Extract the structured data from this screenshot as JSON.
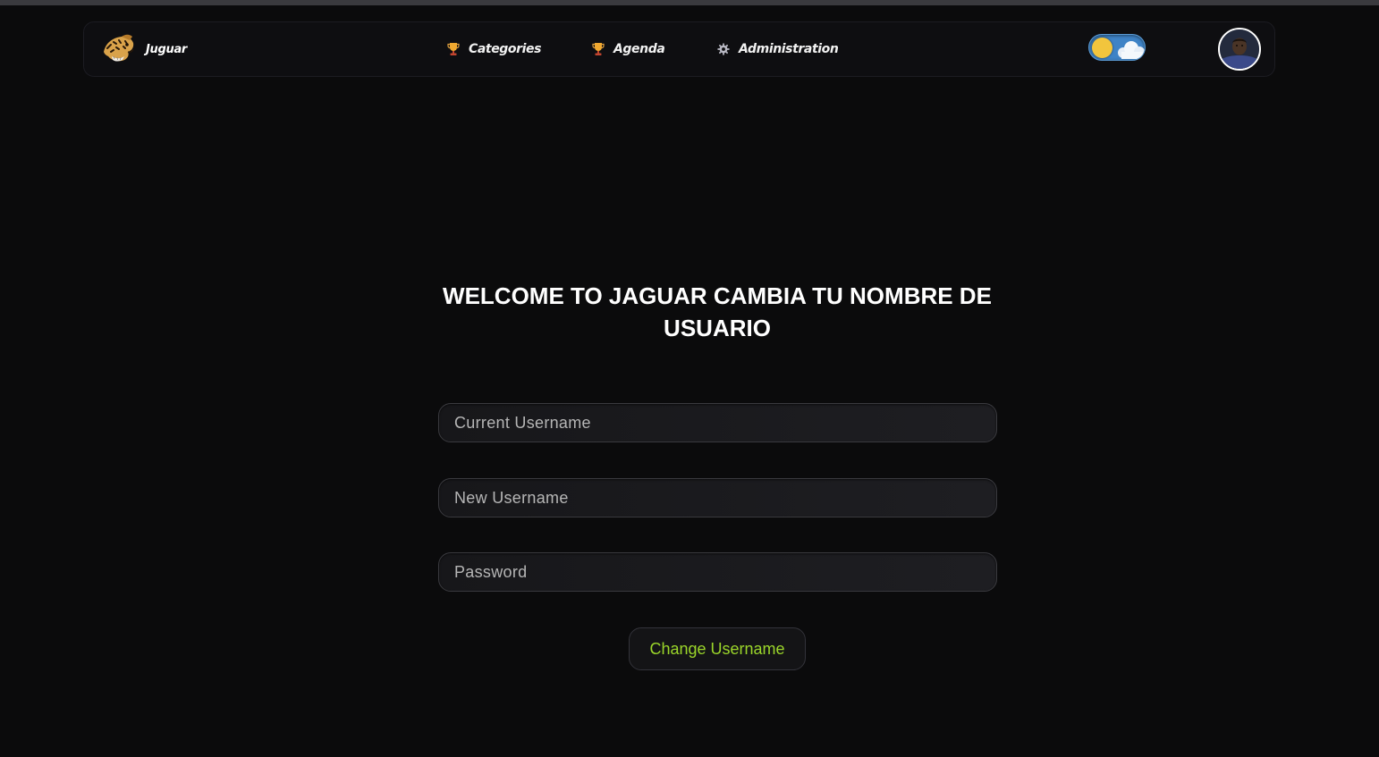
{
  "navbar": {
    "brand": {
      "name": "Juguar",
      "logo_icon": "jaguar-head-icon"
    },
    "items": [
      {
        "label": "Categories",
        "icon": "trophy-icon"
      },
      {
        "label": "Agenda",
        "icon": "trophy-icon"
      },
      {
        "label": "Administration",
        "icon": "gear-icon"
      }
    ],
    "theme_toggle": {
      "state": "light",
      "icon": "sun-cloud-icon"
    },
    "avatar": {
      "icon": "user-avatar"
    }
  },
  "main": {
    "title": "WELCOME TO JAGUAR CAMBIA TU NOMBRE DE USUARIO",
    "fields": {
      "current_username": {
        "placeholder": "Current Username",
        "value": ""
      },
      "new_username": {
        "placeholder": "New Username",
        "value": ""
      },
      "password": {
        "placeholder": "Password",
        "value": ""
      }
    },
    "submit_label": "Change Username"
  },
  "colors": {
    "background": "#0b0b0c",
    "navbar": "#0e0e11",
    "accent_green": "#9bd62a",
    "toggle_blue": "#3e83c6",
    "toggle_sun": "#f2c53d"
  }
}
